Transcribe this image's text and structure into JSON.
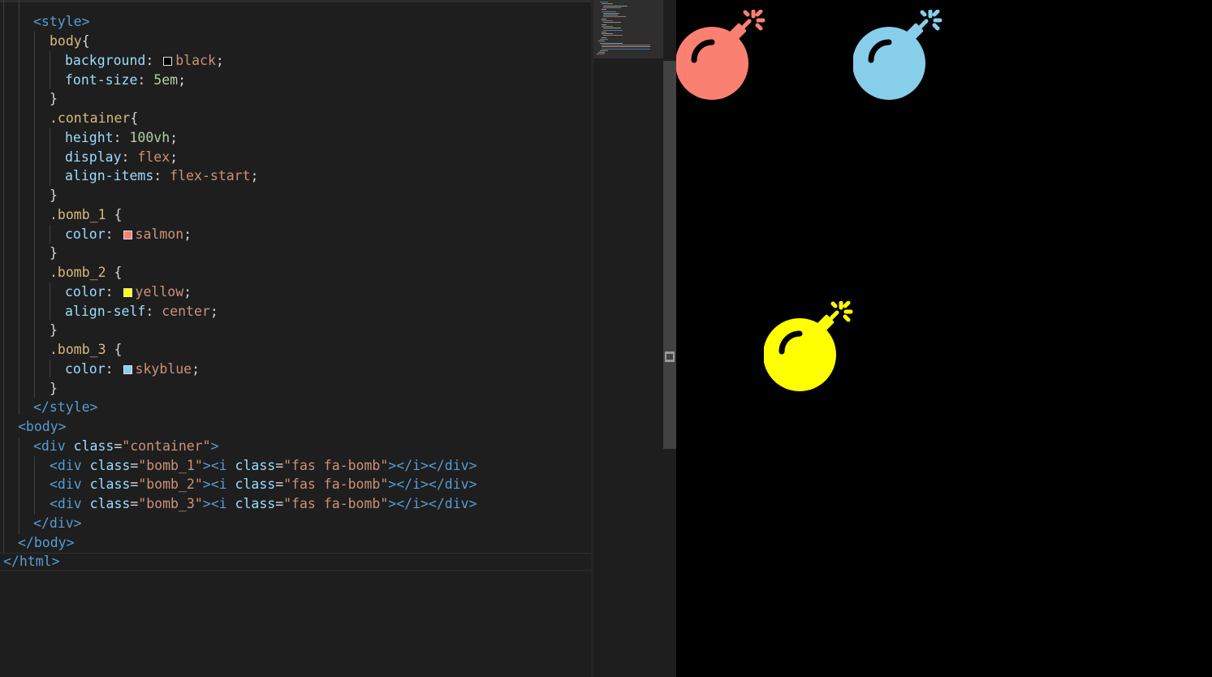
{
  "editor": {
    "lines": [
      [
        [
          "tok-tag",
          "<style>"
        ]
      ],
      [
        [
          "tok-sel",
          "body"
        ],
        [
          "tok-plain",
          "{"
        ]
      ],
      [
        [
          "tok-prop",
          "background"
        ],
        [
          "tok-plain",
          ": "
        ],
        [
          "swatch",
          "#000000"
        ],
        [
          "tok-val",
          "black"
        ],
        [
          "tok-plain",
          ";"
        ]
      ],
      [
        [
          "tok-prop",
          "font-size"
        ],
        [
          "tok-plain",
          ": "
        ],
        [
          "tok-num",
          "5em"
        ],
        [
          "tok-plain",
          ";"
        ]
      ],
      [
        [
          "tok-plain",
          "}"
        ]
      ],
      [
        [
          "tok-sel",
          ".container"
        ],
        [
          "tok-plain",
          "{"
        ]
      ],
      [
        [
          "tok-prop",
          "height"
        ],
        [
          "tok-plain",
          ": "
        ],
        [
          "tok-num",
          "100vh"
        ],
        [
          "tok-plain",
          ";"
        ]
      ],
      [
        [
          "tok-prop",
          "display"
        ],
        [
          "tok-plain",
          ": "
        ],
        [
          "tok-val",
          "flex"
        ],
        [
          "tok-plain",
          ";"
        ]
      ],
      [
        [
          "tok-prop",
          "align-items"
        ],
        [
          "tok-plain",
          ": "
        ],
        [
          "tok-val",
          "flex-start"
        ],
        [
          "tok-plain",
          ";"
        ]
      ],
      [
        [
          "tok-plain",
          "}"
        ]
      ],
      [
        [
          "tok-sel",
          ".bomb_1"
        ],
        [
          "tok-plain",
          " {"
        ]
      ],
      [
        [
          "tok-prop",
          "color"
        ],
        [
          "tok-plain",
          ": "
        ],
        [
          "swatch",
          "#fa8072"
        ],
        [
          "tok-val",
          "salmon"
        ],
        [
          "tok-plain",
          ";"
        ]
      ],
      [
        [
          "tok-plain",
          "}"
        ]
      ],
      [
        [
          "tok-sel",
          ".bomb_2"
        ],
        [
          "tok-plain",
          " {"
        ]
      ],
      [
        [
          "tok-prop",
          "color"
        ],
        [
          "tok-plain",
          ": "
        ],
        [
          "swatch",
          "#ffff00"
        ],
        [
          "tok-val",
          "yellow"
        ],
        [
          "tok-plain",
          ";"
        ]
      ],
      [
        [
          "tok-prop",
          "align-self"
        ],
        [
          "tok-plain",
          ": "
        ],
        [
          "tok-val",
          "center"
        ],
        [
          "tok-plain",
          ";"
        ]
      ],
      [
        [
          "tok-plain",
          "}"
        ]
      ],
      [
        [
          "tok-sel",
          ".bomb_3"
        ],
        [
          "tok-plain",
          " {"
        ]
      ],
      [
        [
          "tok-prop",
          "color"
        ],
        [
          "tok-plain",
          ": "
        ],
        [
          "swatch",
          "#87ceeb"
        ],
        [
          "tok-val",
          "skyblue"
        ],
        [
          "tok-plain",
          ";"
        ]
      ],
      [
        [
          "tok-plain",
          "}"
        ]
      ],
      [
        [
          "tok-tag",
          "</style>"
        ]
      ],
      [
        [
          "tok-tag",
          "<body>"
        ]
      ],
      [
        [
          "tok-tag",
          "<div "
        ],
        [
          "tok-attr",
          "class"
        ],
        [
          "tok-plain",
          "="
        ],
        [
          "tok-str",
          "\"container\""
        ],
        [
          "tok-tag",
          ">"
        ]
      ],
      [
        [
          "tok-tag",
          "<div "
        ],
        [
          "tok-attr",
          "class"
        ],
        [
          "tok-plain",
          "="
        ],
        [
          "tok-str",
          "\"bomb_1\""
        ],
        [
          "tok-tag",
          "><i "
        ],
        [
          "tok-attr",
          "class"
        ],
        [
          "tok-plain",
          "="
        ],
        [
          "tok-str",
          "\"fas fa-bomb\""
        ],
        [
          "tok-tag",
          "></i></div>"
        ]
      ],
      [
        [
          "tok-tag",
          "<div "
        ],
        [
          "tok-attr",
          "class"
        ],
        [
          "tok-plain",
          "="
        ],
        [
          "tok-str",
          "\"bomb_2\""
        ],
        [
          "tok-tag",
          "><i "
        ],
        [
          "tok-attr",
          "class"
        ],
        [
          "tok-plain",
          "="
        ],
        [
          "tok-str",
          "\"fas fa-bomb\""
        ],
        [
          "tok-tag",
          "></i></div>"
        ]
      ],
      [
        [
          "tok-tag",
          "<div "
        ],
        [
          "tok-attr",
          "class"
        ],
        [
          "tok-plain",
          "="
        ],
        [
          "tok-str",
          "\"bomb_3\""
        ],
        [
          "tok-tag",
          "><i "
        ],
        [
          "tok-attr",
          "class"
        ],
        [
          "tok-plain",
          "="
        ],
        [
          "tok-str",
          "\"fas fa-bomb\""
        ],
        [
          "tok-tag",
          "></i></div>"
        ]
      ],
      [
        [
          "tok-tag",
          "</div>"
        ]
      ],
      [
        [
          "tok-tag",
          "</body>"
        ]
      ],
      [
        [
          "tok-tag",
          "</html>"
        ]
      ]
    ]
  },
  "preview": {
    "background": "#000000",
    "bombs": [
      {
        "name": "bomb-1",
        "color": "#fa8072",
        "css_class": "bomb_1"
      },
      {
        "name": "bomb-3",
        "color": "#87ceeb",
        "css_class": "bomb_3"
      },
      {
        "name": "bomb-2",
        "color": "#ffff00",
        "css_class": "bomb_2"
      }
    ]
  }
}
